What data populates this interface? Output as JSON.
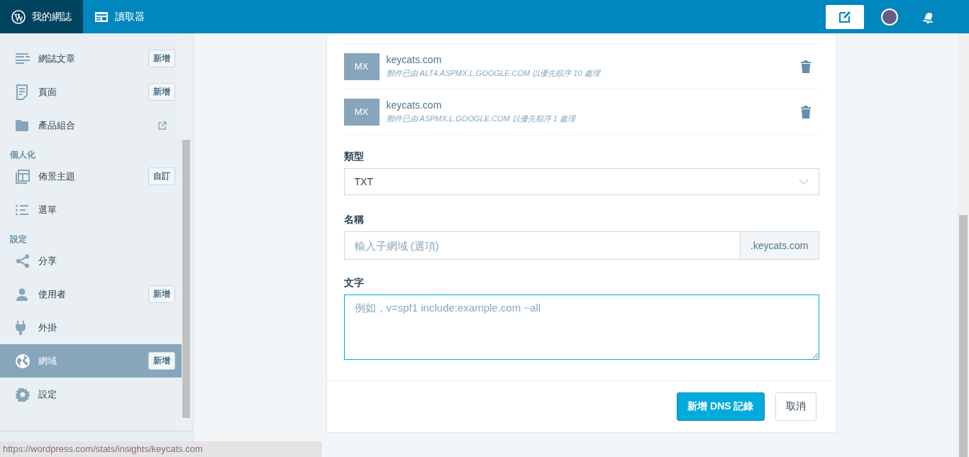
{
  "topbar": {
    "tabs": [
      {
        "label": "我的網誌",
        "selected": true
      },
      {
        "label": "讀取器",
        "selected": false
      }
    ]
  },
  "sidebar": {
    "items": [
      {
        "kind": "item",
        "label": "網誌文章",
        "badge": "新增",
        "selected": false
      },
      {
        "kind": "item",
        "label": "頁面",
        "badge": "新增",
        "selected": false
      },
      {
        "kind": "item",
        "label": "產品組合",
        "external": true,
        "selected": false
      },
      {
        "kind": "heading",
        "label": "個人化"
      },
      {
        "kind": "item",
        "label": "佈景主題",
        "badge": "自訂",
        "selected": false
      },
      {
        "kind": "item",
        "label": "選單",
        "selected": false
      },
      {
        "kind": "heading",
        "label": "設定"
      },
      {
        "kind": "item",
        "label": "分享",
        "selected": false
      },
      {
        "kind": "item",
        "label": "使用者",
        "badge": "新增",
        "selected": false
      },
      {
        "kind": "item",
        "label": "外掛",
        "selected": false
      },
      {
        "kind": "item",
        "label": "網域",
        "badge": "新增",
        "selected": true
      },
      {
        "kind": "item",
        "label": "設定",
        "selected": false
      }
    ]
  },
  "records": [
    {
      "type": "MX",
      "name": "keycats.com",
      "detail": "郵件已由 ALT4.ASPMX.L.GOOGLE.COM 以優先順序 10 處理"
    },
    {
      "type": "MX",
      "name": "keycats.com",
      "detail": "郵件已由 ASPMX.L.GOOGLE.COM 以優先順序 1 處理"
    }
  ],
  "form": {
    "type": {
      "label": "類型",
      "value": "TXT"
    },
    "name": {
      "label": "名稱",
      "placeholder": "輸入子網域 (選項)",
      "suffix": ".keycats.com"
    },
    "text": {
      "label": "文字",
      "placeholder": "例如，v=spf1 include:example.com ~all"
    }
  },
  "buttons": {
    "primary": "新增 DNS 記錄",
    "cancel": "取消"
  },
  "status_bar": {
    "url": "https://wordpress.com/stats/insights/keycats.com"
  }
}
